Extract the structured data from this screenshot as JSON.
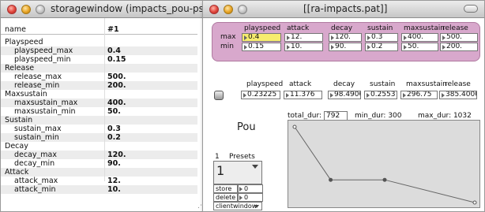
{
  "storagewindow": {
    "title": "storagewindow (impacts_pou-ps)",
    "header": {
      "name": "name",
      "value": "#1"
    },
    "rows": [
      {
        "label": "Playspeed",
        "value": ""
      },
      {
        "label": "playspeed_max",
        "value": "0.4"
      },
      {
        "label": "playspeed_min",
        "value": "0.15"
      },
      {
        "label": "Release",
        "value": ""
      },
      {
        "label": "release_max",
        "value": "500."
      },
      {
        "label": "release_min",
        "value": "200."
      },
      {
        "label": "Maxsustain",
        "value": ""
      },
      {
        "label": "maxsustain_max",
        "value": "400."
      },
      {
        "label": "maxsustain_min",
        "value": "50."
      },
      {
        "label": "Sustain",
        "value": ""
      },
      {
        "label": "sustain_max",
        "value": "0.3"
      },
      {
        "label": "sustain_min",
        "value": "0.2"
      },
      {
        "label": "Decay",
        "value": ""
      },
      {
        "label": "decay_max",
        "value": "120."
      },
      {
        "label": "decay_min",
        "value": "90."
      },
      {
        "label": "Attack",
        "value": ""
      },
      {
        "label": "attack_max",
        "value": "12."
      },
      {
        "label": "attack_min",
        "value": "10."
      }
    ]
  },
  "patcher": {
    "title": "[[ra-impacts.pat]]",
    "columns": [
      "playspeed",
      "attack",
      "decay",
      "sustain",
      "maxsustain",
      "release"
    ],
    "range": {
      "max_label": "max",
      "min_label": "min",
      "max": [
        "0.4",
        "12.",
        "120.",
        "0.3",
        "400.",
        "500."
      ],
      "min": [
        "0.15",
        "10.",
        "90.",
        "0.2",
        "50.",
        "200."
      ]
    },
    "current": [
      "0.23225",
      "11.376",
      "98.49000",
      "0.2553",
      "296.75",
      "385.4000"
    ],
    "name_label": "Pou",
    "total_dur_label": "total_dur:",
    "total_dur": "792",
    "min_dur_label": "min_dur: 300",
    "max_dur_label": "max_dur: 1032",
    "presets_num": "1",
    "presets_label": "Presets",
    "preset_slot": "1",
    "store_label": "store",
    "store_value": "0",
    "delete_label": "delete",
    "delete_value": "0",
    "clientwindow_label": "clientwindow",
    "envelope": {
      "points": [
        [
          0,
          1.0
        ],
        [
          0.2,
          0.3
        ],
        [
          0.5,
          0.3
        ],
        [
          1.0,
          0.0
        ]
      ]
    },
    "colors": {
      "panel": "#d8a8cc",
      "selected_box": "#f7ec6e"
    }
  }
}
